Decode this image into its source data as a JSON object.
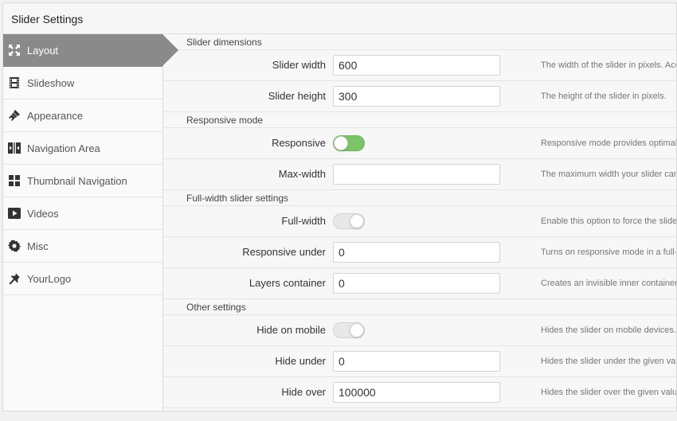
{
  "panel": {
    "title": "Slider Settings"
  },
  "sidebar": {
    "items": [
      {
        "label": "Layout",
        "icon": "expand-icon",
        "active": true
      },
      {
        "label": "Slideshow",
        "icon": "film-icon"
      },
      {
        "label": "Appearance",
        "icon": "brush-icon"
      },
      {
        "label": "Navigation Area",
        "icon": "navigation-icon"
      },
      {
        "label": "Thumbnail Navigation",
        "icon": "grid-icon"
      },
      {
        "label": "Videos",
        "icon": "play-icon"
      },
      {
        "label": "Misc",
        "icon": "gear-icon"
      },
      {
        "label": "YourLogo",
        "icon": "pin-icon"
      }
    ]
  },
  "sections": {
    "dimensions": {
      "title": "Slider dimensions",
      "slider_width": {
        "label": "Slider width",
        "value": "600",
        "help": "The width of the slider in pixels. Acc"
      },
      "slider_height": {
        "label": "Slider height",
        "value": "300",
        "help": "The height of the slider in pixels."
      }
    },
    "responsive": {
      "title": "Responsive mode",
      "responsive": {
        "label": "Responsive",
        "on": true,
        "help": "Responsive mode provides optimal v"
      },
      "max_width": {
        "label": "Max-width",
        "value": "",
        "help": "The maximum width your slider can"
      }
    },
    "fullwidth": {
      "title": "Full-width slider settings",
      "full_width": {
        "label": "Full-width",
        "on": false,
        "help": "Enable this option to force the slider"
      },
      "responsive_under": {
        "label": "Responsive under",
        "value": "0",
        "help": "Turns on responsive mode in a full-v"
      },
      "layers_container": {
        "label": "Layers container",
        "value": "0",
        "help": "Creates an invisible inner container"
      }
    },
    "other": {
      "title": "Other settings",
      "hide_on_mobile": {
        "label": "Hide on mobile",
        "on": false,
        "help": "Hides the slider on mobile devices."
      },
      "hide_under": {
        "label": "Hide under",
        "value": "0",
        "help": "Hides the slider under the given valu"
      },
      "hide_over": {
        "label": "Hide over",
        "value": "100000",
        "help": "Hides the slider over the given valu"
      }
    }
  },
  "colors": {
    "active_tab": "#8a8a8a",
    "toggle_on": "#7cc36a"
  }
}
